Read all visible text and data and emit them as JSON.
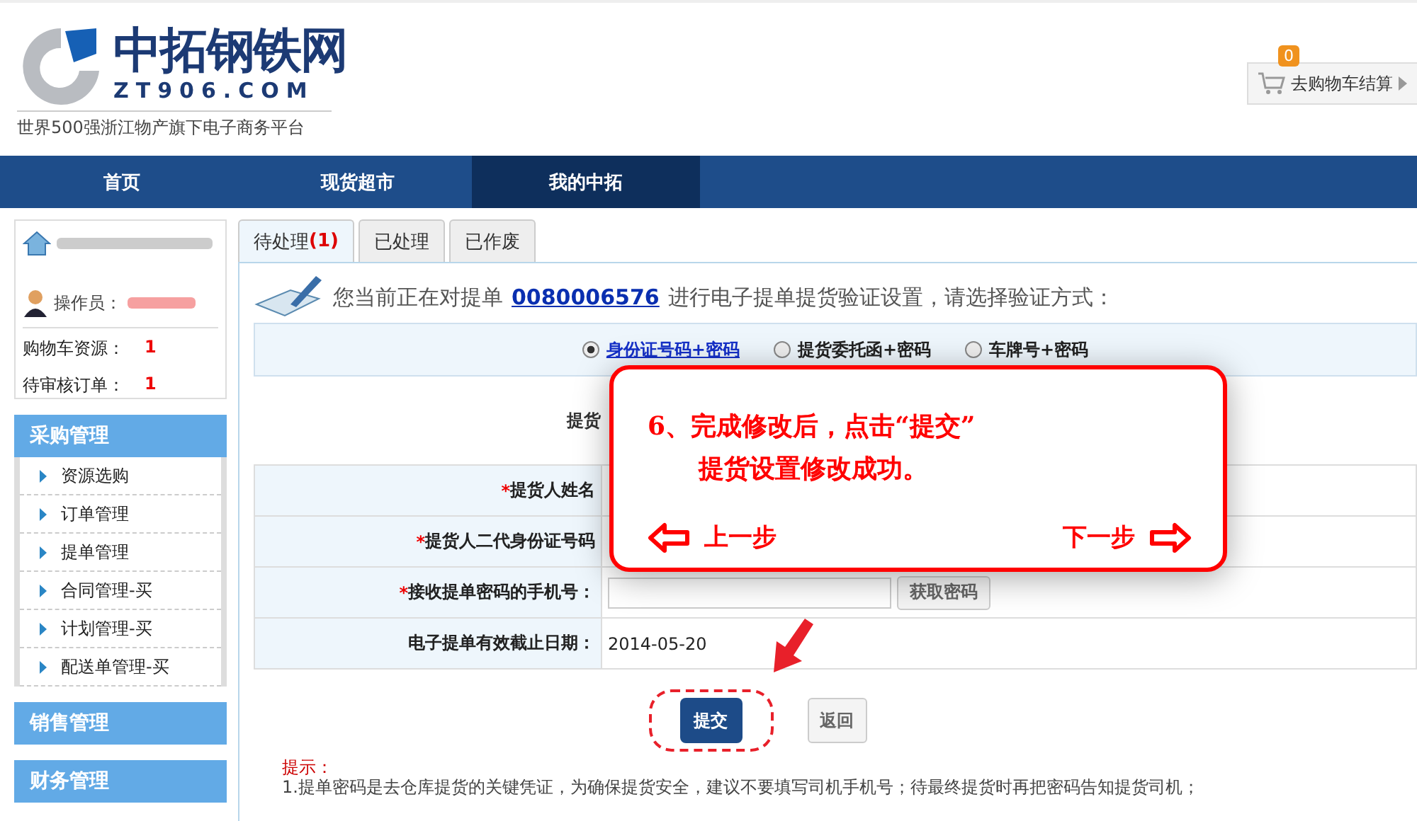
{
  "logo": {
    "name": "中拓钢铁网",
    "domain": "ZT906.COM",
    "slogan": "世界500强浙江物产旗下电子商务平台"
  },
  "cart": {
    "count": "0",
    "label": "去购物车结算"
  },
  "nav": [
    {
      "label": "首页",
      "selected": false
    },
    {
      "label": "现货超市",
      "selected": false
    },
    {
      "label": "我的中拓",
      "selected": true
    }
  ],
  "user": {
    "operator_label": "操作员：",
    "stats": [
      {
        "label": "购物车资源：",
        "value": "1"
      },
      {
        "label": "待审核订单：",
        "value": "1"
      }
    ]
  },
  "sidebar": [
    {
      "title": "采购管理",
      "items": [
        "资源选购",
        "订单管理",
        "提单管理",
        "合同管理-买",
        "计划管理-买",
        "配送单管理-买"
      ]
    },
    {
      "title": "销售管理"
    },
    {
      "title": "财务管理"
    }
  ],
  "tabs": [
    {
      "label": "待处理",
      "count": "(1)",
      "selected": true
    },
    {
      "label": "已处理",
      "selected": false
    },
    {
      "label": "已作废",
      "selected": false
    }
  ],
  "heading": {
    "before": "您当前正在对提单",
    "bill_no": "0080006576",
    "after": "进行电子提单提货验证设置，请选择验证方式："
  },
  "methods": [
    {
      "label": "身份证号码+密码",
      "selected": true
    },
    {
      "label": "提货委托函+密码",
      "selected": false
    },
    {
      "label": "车牌号+密码",
      "selected": false
    }
  ],
  "form": {
    "first_label": "提货",
    "rows": [
      {
        "kind": "text",
        "mark": "*",
        "label": "提货人姓名"
      },
      {
        "kind": "text",
        "mark": "*",
        "label": "提货人二代身份证号码"
      },
      {
        "kind": "phone",
        "mark": "*",
        "label": "接收提单密码的手机号：",
        "button": "获取密码"
      },
      {
        "kind": "value",
        "label": "电子提单有效截止日期：",
        "value": "2014-05-20"
      }
    ]
  },
  "buttons": {
    "submit": "提交",
    "back": "返回"
  },
  "tips": {
    "title": "提示：",
    "lines": [
      "1.提单密码是去仓库提货的关键凭证，为确保提货安全，建议不要填写司机手机号；待最终提货时再把密码告知提货司机；"
    ]
  },
  "guide": {
    "lines": [
      "6、完成修改后，点击“提交”",
      "提货设置修改成功。"
    ],
    "prev": "上一步",
    "next": "下一步"
  }
}
